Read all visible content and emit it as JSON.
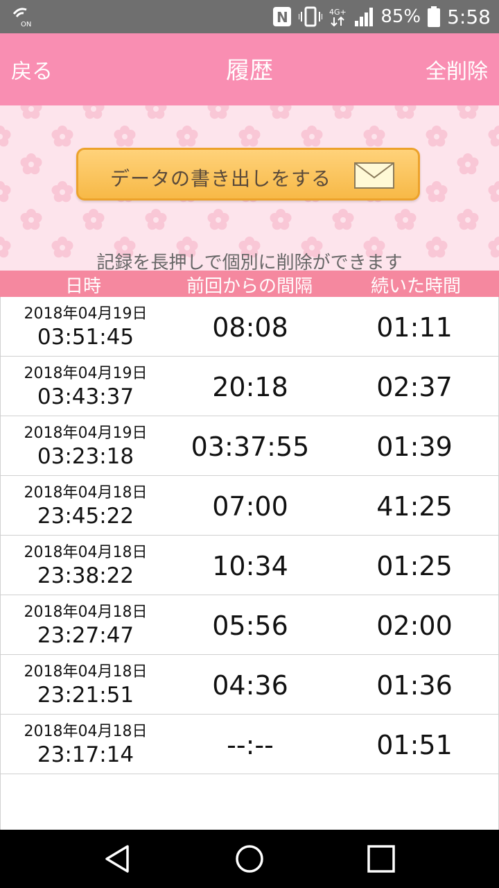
{
  "status_bar": {
    "battery_percent": "85%",
    "time": "5:58",
    "network": "4G+"
  },
  "header": {
    "back_label": "戻る",
    "title": "履歴",
    "delete_all_label": "全削除"
  },
  "export": {
    "button_label": "データの書き出しをする"
  },
  "hint": "記録を長押しで個別に削除ができます",
  "table": {
    "columns": [
      "日時",
      "前回からの間隔",
      "続いた時間"
    ],
    "rows": [
      {
        "date": "2018年04月19日",
        "time": "03:51:45",
        "interval": "08:08",
        "duration": "01:11"
      },
      {
        "date": "2018年04月19日",
        "time": "03:43:37",
        "interval": "20:18",
        "duration": "02:37"
      },
      {
        "date": "2018年04月19日",
        "time": "03:23:18",
        "interval": "03:37:55",
        "duration": "01:39"
      },
      {
        "date": "2018年04月18日",
        "time": "23:45:22",
        "interval": "07:00",
        "duration": "41:25"
      },
      {
        "date": "2018年04月18日",
        "time": "23:38:22",
        "interval": "10:34",
        "duration": "01:25"
      },
      {
        "date": "2018年04月18日",
        "time": "23:27:47",
        "interval": "05:56",
        "duration": "02:00"
      },
      {
        "date": "2018年04月18日",
        "time": "23:21:51",
        "interval": "04:36",
        "duration": "01:36"
      },
      {
        "date": "2018年04月18日",
        "time": "23:17:14",
        "interval": "--:--",
        "duration": "01:51"
      }
    ]
  },
  "colors": {
    "title_bar": "#f98eb2",
    "table_header": "#f5889f",
    "pattern_bg": "#fde4ec",
    "button": "#f7b947"
  }
}
